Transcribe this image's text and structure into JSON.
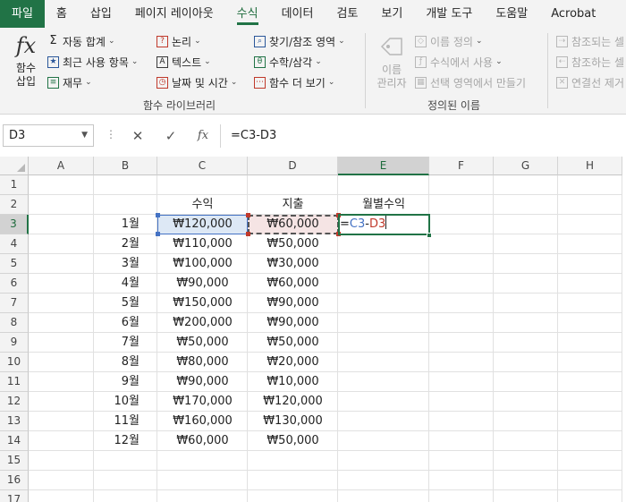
{
  "tabs": [
    {
      "label": "파일",
      "kind": "file"
    },
    {
      "label": "홈"
    },
    {
      "label": "삽입"
    },
    {
      "label": "페이지 레이아웃"
    },
    {
      "label": "수식",
      "kind": "active"
    },
    {
      "label": "데이터"
    },
    {
      "label": "검토"
    },
    {
      "label": "보기"
    },
    {
      "label": "개발 도구"
    },
    {
      "label": "도움말"
    },
    {
      "label": "Acrobat"
    }
  ],
  "ribbon": {
    "insert_function": "함수\n삽입",
    "autosum": "자동 합계",
    "recent": "최근 사용 항목",
    "financial": "재무",
    "logical": "논리",
    "text": "텍스트",
    "datetime": "날짜 및 시간",
    "lookup": "찾기/참조 영역",
    "math": "수학/삼각",
    "more": "함수 더 보기",
    "group_library": "함수 라이브러리",
    "name_manager": "이름\n관리자",
    "define_name": "이름 정의",
    "use_in_formula": "수식에서 사용",
    "create_from_selection": "선택 영역에서 만들기",
    "group_defined": "정의된 이름",
    "trace_precedents": "참조되는 셀",
    "trace_dependents": "참조하는 셀",
    "remove_arrows": "연결선 제거"
  },
  "formula_bar": {
    "name_box": "D3",
    "formula": "=C3-D3",
    "icon_cancel": "✕",
    "icon_enter": "✓",
    "icon_fx": "fx"
  },
  "columns": [
    "A",
    "B",
    "C",
    "D",
    "E",
    "F",
    "G",
    "H"
  ],
  "rows": [
    "1",
    "2",
    "3",
    "4",
    "5",
    "6",
    "7",
    "8",
    "9",
    "10",
    "11",
    "12",
    "13",
    "14",
    "15",
    "16",
    "17"
  ],
  "headers": {
    "income": "수익",
    "expense": "지출",
    "monthly": "월별수익"
  },
  "data": [
    {
      "month": "1월",
      "income": "₩120,000",
      "expense": "₩60,000"
    },
    {
      "month": "2월",
      "income": "₩110,000",
      "expense": "₩50,000"
    },
    {
      "month": "3월",
      "income": "₩100,000",
      "expense": "₩30,000"
    },
    {
      "month": "4월",
      "income": "₩90,000",
      "expense": "₩60,000"
    },
    {
      "month": "5월",
      "income": "₩150,000",
      "expense": "₩90,000"
    },
    {
      "month": "6월",
      "income": "₩200,000",
      "expense": "₩90,000"
    },
    {
      "month": "7월",
      "income": "₩50,000",
      "expense": "₩50,000"
    },
    {
      "month": "8월",
      "income": "₩80,000",
      "expense": "₩20,000"
    },
    {
      "month": "9월",
      "income": "₩90,000",
      "expense": "₩10,000"
    },
    {
      "month": "10월",
      "income": "₩170,000",
      "expense": "₩120,000"
    },
    {
      "month": "11월",
      "income": "₩160,000",
      "expense": "₩130,000"
    },
    {
      "month": "12월",
      "income": "₩60,000",
      "expense": "₩50,000"
    }
  ],
  "edit": {
    "eq": "=",
    "ref1": "C3",
    "op": "-",
    "ref2": "D3"
  },
  "colors": {
    "accent": "#217346",
    "ref_blue": "#4472c4",
    "ref_red": "#c0392b"
  }
}
